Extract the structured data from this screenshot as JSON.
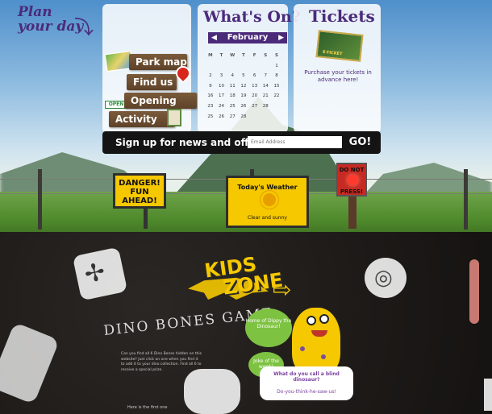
{
  "plan": {
    "title_line1": "Plan",
    "title_line2": "your day",
    "links": [
      "Park map",
      "Find us",
      "Opening times",
      "Activity List"
    ],
    "open_tag": "OPEN"
  },
  "whats_on": {
    "title": "What's On?",
    "month": "February",
    "prev": "◀",
    "next": "▶",
    "weekdays": [
      "M",
      "T",
      "W",
      "T",
      "F",
      "S",
      "S"
    ],
    "weeks": [
      [
        "",
        "",
        "",
        "",
        "",
        "",
        "1"
      ],
      [
        "2",
        "3",
        "4",
        "5",
        "6",
        "7",
        "8"
      ],
      [
        "9",
        "10",
        "11",
        "12",
        "13",
        "14",
        "15"
      ],
      [
        "16",
        "17",
        "18",
        "19",
        "20",
        "21",
        "22"
      ],
      [
        "23",
        "24",
        "25",
        "26",
        "27",
        "28",
        ""
      ],
      [
        "25",
        "26",
        "27",
        "28",
        "",
        "",
        ""
      ]
    ]
  },
  "tickets": {
    "title": "Tickets",
    "ticket_label": "E-TICKET",
    "text": "Purchase your tickets in advance here!"
  },
  "signup": {
    "label": "Sign up for news and offers",
    "email_placeholder": "Email Address",
    "go_label": "GO!"
  },
  "signs": {
    "danger": "DANGER! FUN AHEAD!",
    "weather_title": "Today's Weather",
    "weather_status": "Clear and sunny",
    "donot_top": "DO NOT",
    "donot_bottom": "PRESS!"
  },
  "underground": {
    "kids_line1": "KIDS",
    "kids_line2": "ZONE",
    "arrow": "⇨",
    "bones_title": "DINO BONES GAME",
    "bones_body": "Can you find all 6 Dino Bones hidden on this website? Just click on one when you find it to add it to your dino collection. Find all 6 to receive a special prize.",
    "bones_foot": "Here is the first one",
    "bubble_home": "Home of Dippy the Dinosaur!",
    "bubble_joke": "Joke of the week!",
    "joke_question": "What do you call a blind dinosaur?",
    "joke_answer": "Do-you-think-he-saw-us!"
  },
  "colors": {
    "accent_purple": "#4b2a7a",
    "sign_yellow": "#f5c800",
    "danger_red": "#c62a23",
    "bubble_green": "#7ec242"
  },
  "icons": {
    "map": "map-thumbnail-icon",
    "pin": "map-pin-icon",
    "list": "clipboard-icon",
    "sun": "sun-icon",
    "dragonfly": "dragonfly-fossil-icon",
    "ammonite": "ammonite-fossil-icon"
  }
}
